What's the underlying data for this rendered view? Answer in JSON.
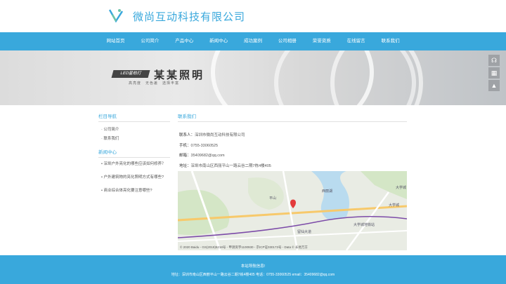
{
  "header": {
    "site_title": "微尚互动科技有限公司"
  },
  "nav": {
    "items": [
      "网站首页",
      "公司简介",
      "产品中心",
      "新闻中心",
      "成功案例",
      "公司相册",
      "荣誉资质",
      "在线留言",
      "联系我们"
    ]
  },
  "banner": {
    "badge": "LED星柏灯",
    "title": "某某照明",
    "subtitle": "高亮度　无色差　选择丰富"
  },
  "sidebar": {
    "nav_title": "栏目导航",
    "links": [
      "公司简介",
      "联系我们"
    ],
    "news_title": "新闻中心",
    "news": [
      "深圳户外亮化的哪些应该如何修养？",
      "户外建筑物的亮化照明方式有哪些?",
      "商业综合体亮化要注意哪些?"
    ]
  },
  "contact": {
    "title": "联系我们",
    "company_label": "联系人：",
    "company_value": "深圳市微尚互动科技有限公司",
    "phone_label": "手机：",
    "phone_value": "0755-33060525",
    "email_label": "邮箱：",
    "email_value": "35409682@qq.com",
    "address_label": "地址：",
    "address_value": "深圳市南山区西丽平山一路云谷二期7栋4楼405"
  },
  "map": {
    "footer_text": "© 2020 Baidu - GS(2019)5218号 - 甲测资字1100930 - 京ICP证030173号 - Data © 长地万方",
    "labels": [
      "西丽湖",
      "大学城",
      "平山",
      "留仙大道",
      "大学城地铁站",
      "大学城"
    ]
  },
  "footer": {
    "title": "本站导航信息!",
    "address": "地址：深圳市南山区西丽平山一路云谷二期7栋4楼405 电话：0755-33060525 email：35409682@qq.com"
  },
  "colors": {
    "brand": "#39a8dc",
    "footer": "#39a8dc"
  },
  "icons": {
    "logo": "logo-icon",
    "headset": "headset-icon",
    "qrcode": "qrcode-icon",
    "top": "back-to-top-icon"
  }
}
